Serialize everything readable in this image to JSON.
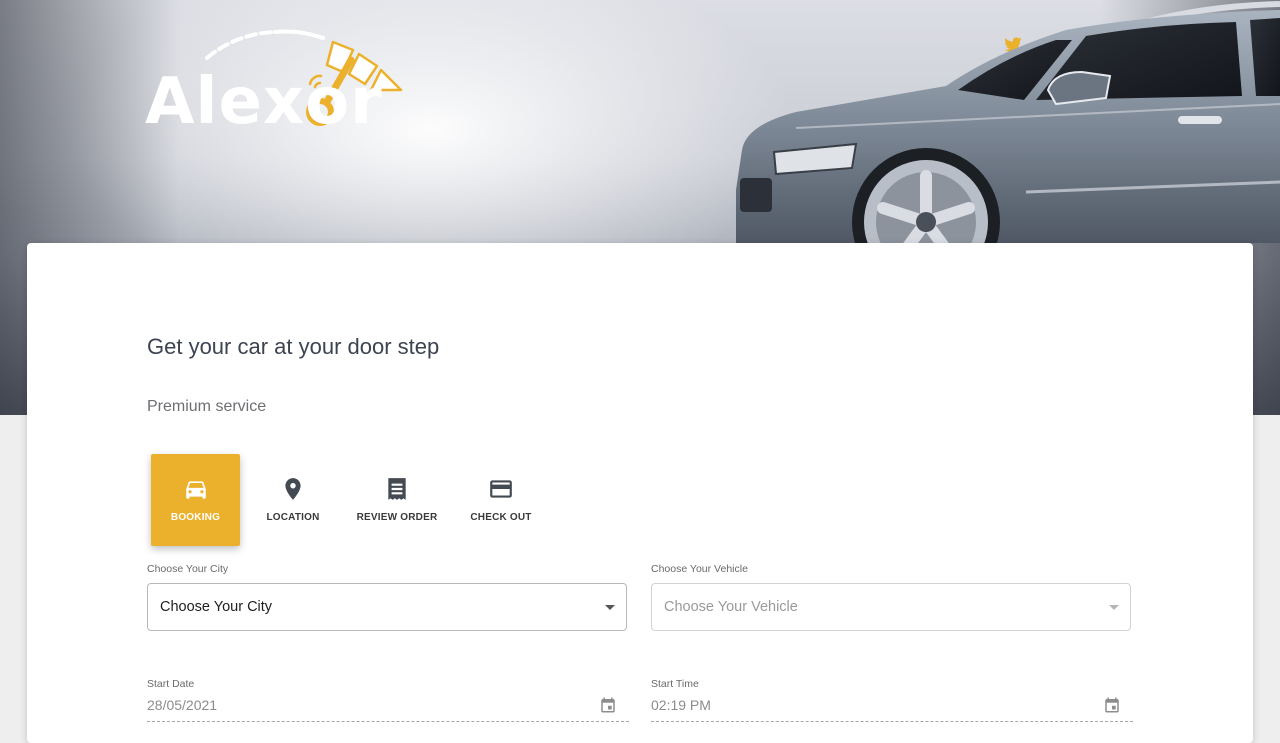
{
  "brand": {
    "logo_text": "Alexor",
    "accent_color": "#ebb12c"
  },
  "header": {
    "social": [
      {
        "name": "twitter-icon"
      },
      {
        "name": "facebook-icon"
      },
      {
        "name": "instagram-icon"
      }
    ]
  },
  "card": {
    "headline": "Get your car at your door step",
    "subline": "Premium service"
  },
  "steps": [
    {
      "label": "BOOKING",
      "icon": "car-icon",
      "active": true
    },
    {
      "label": "LOCATION",
      "icon": "location-pin-icon",
      "active": false
    },
    {
      "label": "REVIEW ORDER",
      "icon": "receipt-icon",
      "active": false
    },
    {
      "label": "CHECK OUT",
      "icon": "credit-card-icon",
      "active": false
    }
  ],
  "form": {
    "city": {
      "label": "Choose Your City",
      "value": "Choose Your City"
    },
    "vehicle": {
      "label": "Choose Your Vehicle",
      "value": "Choose Your Vehicle",
      "disabled": true
    },
    "start_date": {
      "label": "Start Date",
      "value": "28/05/2021"
    },
    "start_time": {
      "label": "Start Time",
      "value": "02:19 PM"
    }
  }
}
